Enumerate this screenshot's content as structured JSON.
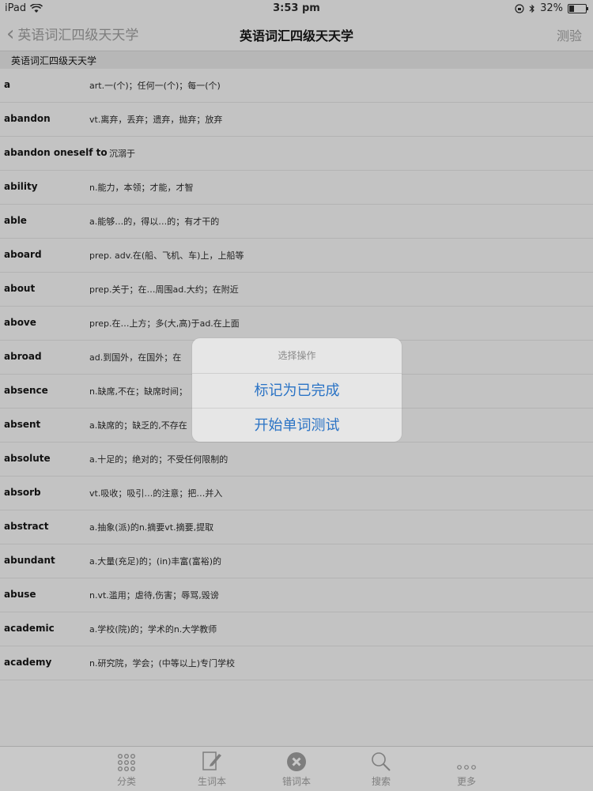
{
  "status": {
    "device": "iPad",
    "time": "3:53 pm",
    "battery": "32%",
    "battery_level": 0.32
  },
  "nav": {
    "back_label": "英语词汇四级天天学",
    "title": "英语词汇四级天天学",
    "right_label": "测验"
  },
  "section_header": "英语词汇四级天天学",
  "words": [
    {
      "word": "a",
      "def": "art.一(个)；任何一(个)；每一(个)"
    },
    {
      "word": "abandon",
      "def": "vt.离弃，丢弃；遗弃，抛弃；放弃"
    },
    {
      "word": "abandon oneself to",
      "def": "沉溺于"
    },
    {
      "word": "ability",
      "def": "n.能力，本领；才能，才智"
    },
    {
      "word": "able",
      "def": "a.能够…的，得以…的；有才干的"
    },
    {
      "word": "aboard",
      "def": "prep. adv.在(船、飞机、车)上，上船等"
    },
    {
      "word": "about",
      "def": "prep.关于；在…周围ad.大约；在附近"
    },
    {
      "word": "above",
      "def": "prep.在…上方；多(大,高)于ad.在上面"
    },
    {
      "word": "abroad",
      "def": "ad.到国外，在国外；在"
    },
    {
      "word": "absence",
      "def": "n.缺席,不在；缺席时间；"
    },
    {
      "word": "absent",
      "def": "a.缺席的；缺乏的,不存在"
    },
    {
      "word": "absolute",
      "def": "a.十足的；绝对的；不受任何限制的"
    },
    {
      "word": "absorb",
      "def": "vt.吸收；吸引…的注意；把…并入"
    },
    {
      "word": "abstract",
      "def": "a.抽象(派)的n.摘要vt.摘要,提取"
    },
    {
      "word": "abundant",
      "def": "a.大量(充足)的；(in)丰富(富裕)的"
    },
    {
      "word": "abuse",
      "def": "n.vt.滥用；虐待,伤害；辱骂,毁谤"
    },
    {
      "word": "academic",
      "def": "a.学校(院)的；学术的n.大学教师"
    },
    {
      "word": "academy",
      "def": "n.研究院，学会；(中等以上)专门学校"
    }
  ],
  "dialog": {
    "title": "选择操作",
    "option_1": "标记为已完成",
    "option_2": "开始单词测试"
  },
  "tabs": [
    {
      "label": "分类",
      "icon": "grid-icon"
    },
    {
      "label": "生词本",
      "icon": "notebook-edit-icon"
    },
    {
      "label": "错词本",
      "icon": "close-circle-icon"
    },
    {
      "label": "搜索",
      "icon": "search-icon"
    },
    {
      "label": "更多",
      "icon": "more-icon"
    }
  ],
  "colors": {
    "accent": "#2a73c5",
    "background": "#c3c3c3"
  }
}
